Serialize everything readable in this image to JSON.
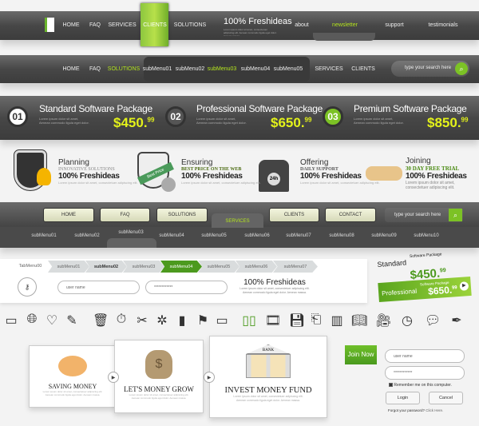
{
  "nav1": {
    "items": [
      "HOME",
      "FAQ",
      "SERVICES",
      "CLIENTS",
      "SOLUTIONS"
    ],
    "active": "CLIENTS",
    "brand": "100% Freshideas",
    "brand_sub": "Lorem ipsum dolor sit amet, consectetuer adipiscing elit. Aenean commodo ligula eget dolor. Aenean massa.",
    "links": [
      "about",
      "newsletter",
      "support",
      "testimonials"
    ]
  },
  "nav2": {
    "items_left": [
      "HOME",
      "FAQ",
      "SOLUTIONS"
    ],
    "submenu": [
      "subMenu01",
      "subMenu02",
      "subMenu03",
      "subMenu04",
      "subMenu05"
    ],
    "items_right": [
      "SERVICES",
      "CLIENTS"
    ],
    "search_placeholder": "type your search here"
  },
  "packages": [
    {
      "num": "01",
      "title": "Standard Software Package",
      "desc1": "Lorem ipsum dolor sit amet,",
      "desc2": "Aenean commodo ligula eget dolor.",
      "price": "$450.",
      "cents": "99"
    },
    {
      "num": "02",
      "title": "Professional Software Package",
      "desc1": "Lorem ipsum dolor sit amet,",
      "desc2": "Aenean commodo ligula eget dolor.",
      "price": "$650.",
      "cents": "99"
    },
    {
      "num": "03",
      "title": "Premium Software Package",
      "desc1": "Lorem ipsum dolor sit amet,",
      "desc2": "Aenean commodo ligula eget dolor.",
      "price": "$850.",
      "cents": "99"
    }
  ],
  "features": [
    {
      "title": "Planning",
      "sub": "INNOVATIVE SOLUTIONS",
      "brand": "100% Freshideas",
      "text": "Lorem ipsum dolor sit amet, consectetuer adipiscing elit.",
      "sub_color": "#888888"
    },
    {
      "title": "Ensuring",
      "sub": "BEST PRICE ON THE WEB",
      "brand": "100% Freshideas",
      "text": "Lorem ipsum dolor sit amet, consectetuer adipiscing elit.",
      "sub_color": "#4a6a10",
      "badge": "Best Price"
    },
    {
      "title": "Offering",
      "sub": "DAILY SUPPORT",
      "brand": "100% Freshideas",
      "text": "Lorem ipsum dolor sit amet, consectetuer adipiscing elit.",
      "sub_color": "#555555",
      "badge": "24h"
    },
    {
      "title": "Joining",
      "sub": "30 DAY FREE TRIAL",
      "brand": "100% Freshideas",
      "text": "Lorem ipsum dolor sit amet, consectetuer adipiscing elit.",
      "sub_color": "#5a9a1a"
    }
  ],
  "nav3": {
    "buttons": [
      "HOME",
      "FAQ",
      "SOLUTIONS",
      "SERVICES",
      "CLIENTS",
      "CONTACT"
    ],
    "active": "SERVICES",
    "search_placeholder": "type your search here",
    "submenu": [
      "subMenu01",
      "subMenu02",
      "subMenu03",
      "subMenu04",
      "subMenu05",
      "subMenu06",
      "subMenu07",
      "subMenu08",
      "subMenu09",
      "subMenu10"
    ],
    "active_sub": "subMenu03"
  },
  "tabs": {
    "items": [
      "TabMenu00",
      "subMenu01",
      "subMenu02",
      "subMenu03",
      "subMenu04",
      "subMenu05",
      "subMenu06",
      "subMenu07"
    ],
    "active": "subMenu04"
  },
  "login_row": {
    "username_placeholder": "user name",
    "password_value": "************",
    "brand": "100% Freshideas",
    "text1": "Lorem ipsum dolor sit amet, consectetuer adipiscing elit.",
    "text2": "Aenean commodo ligula eget dolor. Aenean massa."
  },
  "price_tags": [
    {
      "name": "Standard",
      "label": "Software Package",
      "price": "$450.",
      "cents": "99"
    },
    {
      "name": "Professional",
      "label": "Software Package",
      "price": "$650.",
      "cents": "99"
    }
  ],
  "icons": [
    "window-cursor",
    "globe-upload",
    "heart-plus",
    "edit-document",
    "trash",
    "stopwatch",
    "tools",
    "network",
    "bar-chart",
    "flag",
    "laptop",
    "battery",
    "film",
    "floppy-upload",
    "door",
    "binders",
    "book",
    "video-camera",
    "clock",
    "chat-bubbles",
    "feather"
  ],
  "cards": [
    {
      "title": "SAVING MONEY",
      "text1": "Lorem ipsum dolor sit amet, consectetuer adipiscing elit.",
      "text2": "Aenean commodo ligula eget dolor. Aenean massa."
    },
    {
      "title": "LET'S MONEY GROW",
      "text1": "Lorem ipsum dolor sit amet, consectetuer adipiscing elit.",
      "text2": "Aenean commodo ligula eget dolor. Aenean massa."
    },
    {
      "title": "INVEST MONEY FUND",
      "bank": "BANK",
      "text1": "Lorem ipsum dolor sit amet, consectetuer adipiscing elit.",
      "text2": "Aenean commodo ligula eget dolor. Aenean massa."
    }
  ],
  "signin": {
    "join": "Join Now",
    "username_placeholder": "user name",
    "password_value": "************",
    "remember": "Remember me on this computer.",
    "login": "Login",
    "cancel": "Cancel",
    "forgot": "Forgot your password?",
    "click_here": "Click Here."
  },
  "colors": {
    "accent_green": "#6ab42c",
    "price_yellow": "#e3f21a",
    "bar_dark": "#474747"
  }
}
